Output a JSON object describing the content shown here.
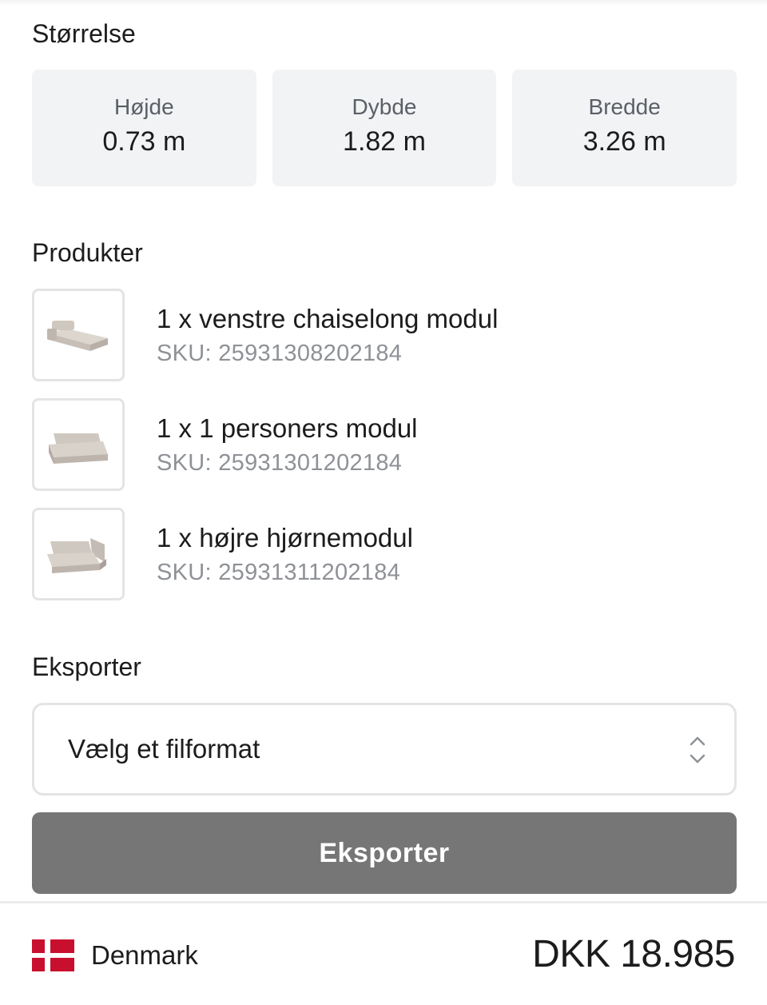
{
  "size_section": {
    "title": "Størrelse",
    "dimensions": [
      {
        "label": "Højde",
        "value": "0.73 m"
      },
      {
        "label": "Dybde",
        "value": "1.82 m"
      },
      {
        "label": "Bredde",
        "value": "3.26 m"
      }
    ]
  },
  "products_section": {
    "title": "Produkter",
    "items": [
      {
        "name": "1 x venstre chaiselong modul",
        "sku": "SKU: 25931308202184",
        "icon": "chaiselong-module-thumbnail"
      },
      {
        "name": "1 x 1 personers modul",
        "sku": "SKU: 25931301202184",
        "icon": "single-seat-module-thumbnail"
      },
      {
        "name": "1 x højre hjørnemodul",
        "sku": "SKU: 25931311202184",
        "icon": "corner-module-thumbnail"
      }
    ]
  },
  "export_section": {
    "title": "Eksporter",
    "select_value": "Vælg et filformat",
    "button_label": "Eksporter"
  },
  "footer": {
    "country": "Denmark",
    "price": "DKK 18.985"
  },
  "colors": {
    "card_bg": "#f2f3f5",
    "button_bg": "#767676",
    "sofa": "#cdc5bd",
    "flag_red": "#c8102e"
  }
}
